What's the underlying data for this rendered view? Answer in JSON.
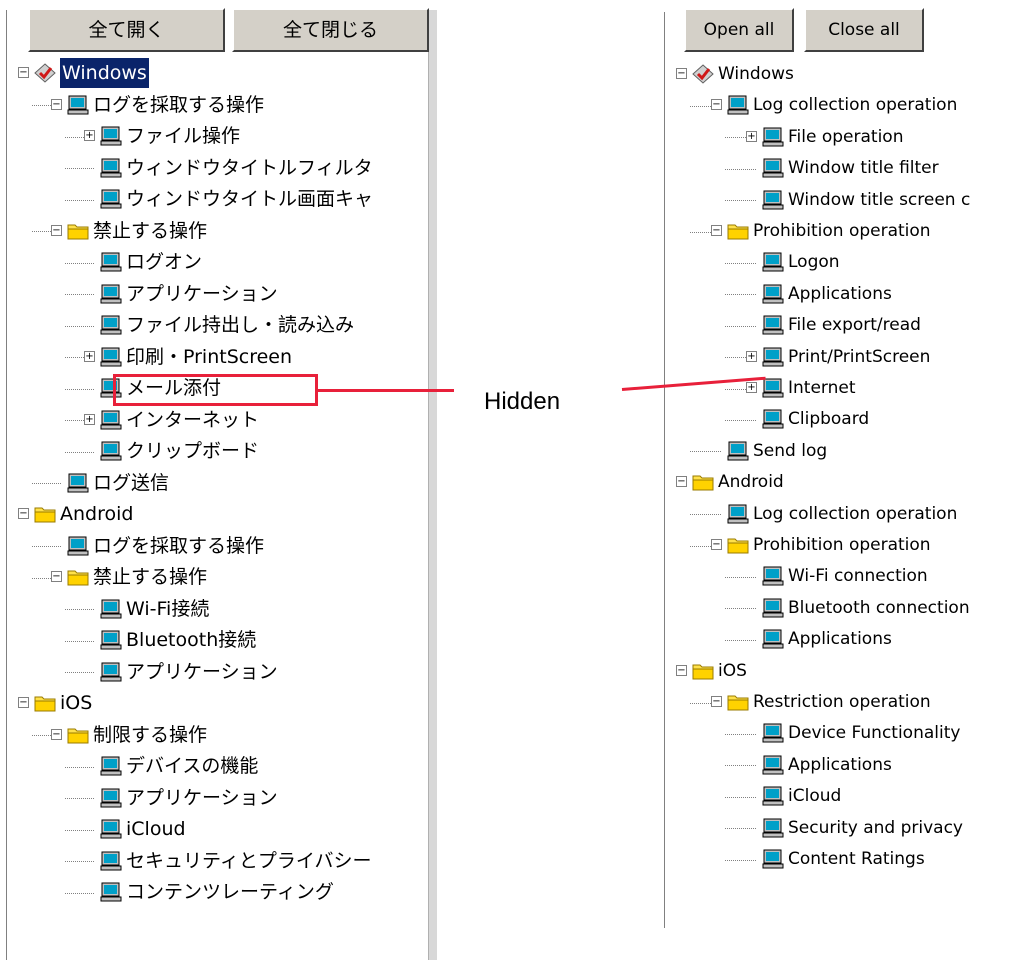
{
  "left": {
    "buttons": {
      "open_all": "全て開く",
      "close_all": "全て閉じる"
    },
    "items": [
      {
        "label": "Windows",
        "depth": 0,
        "icon": "windows-diamond-icon",
        "expander": "minus",
        "selected": true
      },
      {
        "label": "ログを採取する操作",
        "depth": 1,
        "icon": "computer-icon",
        "expander": "minus"
      },
      {
        "label": "ファイル操作",
        "depth": 2,
        "icon": "computer-icon",
        "expander": "plus"
      },
      {
        "label": "ウィンドウタイトルフィルタ",
        "depth": 2,
        "icon": "computer-icon",
        "expander": ""
      },
      {
        "label": "ウィンドウタイトル画面キャ",
        "depth": 2,
        "icon": "computer-icon",
        "expander": ""
      },
      {
        "label": "禁止する操作",
        "depth": 1,
        "icon": "folder-icon",
        "expander": "minus"
      },
      {
        "label": "ログオン",
        "depth": 2,
        "icon": "computer-icon",
        "expander": ""
      },
      {
        "label": "アプリケーション",
        "depth": 2,
        "icon": "computer-icon",
        "expander": ""
      },
      {
        "label": "ファイル持出し・読み込み",
        "depth": 2,
        "icon": "computer-icon",
        "expander": ""
      },
      {
        "label": "印刷・PrintScreen",
        "depth": 2,
        "icon": "computer-icon",
        "expander": "plus"
      },
      {
        "label": "メール添付",
        "depth": 2,
        "icon": "computer-icon",
        "expander": ""
      },
      {
        "label": "インターネット",
        "depth": 2,
        "icon": "computer-icon",
        "expander": "plus"
      },
      {
        "label": "クリップボード",
        "depth": 2,
        "icon": "computer-icon",
        "expander": ""
      },
      {
        "label": "ログ送信",
        "depth": 1,
        "icon": "computer-icon",
        "expander": ""
      },
      {
        "label": "Android",
        "depth": 0,
        "icon": "folder-icon",
        "expander": "minus"
      },
      {
        "label": "ログを採取する操作",
        "depth": 1,
        "icon": "computer-icon",
        "expander": ""
      },
      {
        "label": "禁止する操作",
        "depth": 1,
        "icon": "folder-icon",
        "expander": "minus"
      },
      {
        "label": "Wi-Fi接続",
        "depth": 2,
        "icon": "computer-icon",
        "expander": ""
      },
      {
        "label": "Bluetooth接続",
        "depth": 2,
        "icon": "computer-icon",
        "expander": ""
      },
      {
        "label": "アプリケーション",
        "depth": 2,
        "icon": "computer-icon",
        "expander": ""
      },
      {
        "label": "iOS",
        "depth": 0,
        "icon": "folder-icon",
        "expander": "minus"
      },
      {
        "label": "制限する操作",
        "depth": 1,
        "icon": "folder-icon",
        "expander": "minus"
      },
      {
        "label": "デバイスの機能",
        "depth": 2,
        "icon": "computer-icon",
        "expander": ""
      },
      {
        "label": "アプリケーション",
        "depth": 2,
        "icon": "computer-icon",
        "expander": ""
      },
      {
        "label": "iCloud",
        "depth": 2,
        "icon": "computer-icon",
        "expander": ""
      },
      {
        "label": "セキュリティとプライバシー",
        "depth": 2,
        "icon": "computer-icon",
        "expander": ""
      },
      {
        "label": "コンテンツレーティング",
        "depth": 2,
        "icon": "computer-icon",
        "expander": ""
      }
    ]
  },
  "right": {
    "buttons": {
      "open_all": "Open all",
      "close_all": "Close all"
    },
    "items": [
      {
        "label": "Windows",
        "depth": 0,
        "icon": "windows-diamond-icon",
        "expander": "minus"
      },
      {
        "label": "Log collection operation",
        "depth": 1,
        "icon": "computer-icon",
        "expander": "minus"
      },
      {
        "label": "File operation",
        "depth": 2,
        "icon": "computer-icon",
        "expander": "plus"
      },
      {
        "label": "Window title filter",
        "depth": 2,
        "icon": "computer-icon",
        "expander": ""
      },
      {
        "label": "Window title screen c",
        "depth": 2,
        "icon": "computer-icon",
        "expander": ""
      },
      {
        "label": "Prohibition operation",
        "depth": 1,
        "icon": "folder-icon",
        "expander": "minus"
      },
      {
        "label": "Logon",
        "depth": 2,
        "icon": "computer-icon",
        "expander": ""
      },
      {
        "label": "Applications",
        "depth": 2,
        "icon": "computer-icon",
        "expander": ""
      },
      {
        "label": "File export/read",
        "depth": 2,
        "icon": "computer-icon",
        "expander": ""
      },
      {
        "label": "Print/PrintScreen",
        "depth": 2,
        "icon": "computer-icon",
        "expander": "plus"
      },
      {
        "label": "Internet",
        "depth": 2,
        "icon": "computer-icon",
        "expander": "plus"
      },
      {
        "label": "Clipboard",
        "depth": 2,
        "icon": "computer-icon",
        "expander": ""
      },
      {
        "label": "Send log",
        "depth": 1,
        "icon": "computer-icon",
        "expander": ""
      },
      {
        "label": "Android",
        "depth": 0,
        "icon": "folder-icon",
        "expander": "minus"
      },
      {
        "label": "Log collection operation",
        "depth": 1,
        "icon": "computer-icon",
        "expander": ""
      },
      {
        "label": "Prohibition operation",
        "depth": 1,
        "icon": "folder-icon",
        "expander": "minus"
      },
      {
        "label": "Wi-Fi connection",
        "depth": 2,
        "icon": "computer-icon",
        "expander": ""
      },
      {
        "label": "Bluetooth connection",
        "depth": 2,
        "icon": "computer-icon",
        "expander": ""
      },
      {
        "label": "Applications",
        "depth": 2,
        "icon": "computer-icon",
        "expander": ""
      },
      {
        "label": "iOS",
        "depth": 0,
        "icon": "folder-icon",
        "expander": "minus"
      },
      {
        "label": "Restriction operation",
        "depth": 1,
        "icon": "folder-icon",
        "expander": "minus"
      },
      {
        "label": "Device Functionality",
        "depth": 2,
        "icon": "computer-icon",
        "expander": ""
      },
      {
        "label": "Applications",
        "depth": 2,
        "icon": "computer-icon",
        "expander": ""
      },
      {
        "label": "iCloud",
        "depth": 2,
        "icon": "computer-icon",
        "expander": ""
      },
      {
        "label": "Security and privacy",
        "depth": 2,
        "icon": "computer-icon",
        "expander": ""
      },
      {
        "label": "Content Ratings",
        "depth": 2,
        "icon": "computer-icon",
        "expander": ""
      }
    ]
  },
  "annotation": {
    "label": "Hidden",
    "color": "#e8203a"
  }
}
